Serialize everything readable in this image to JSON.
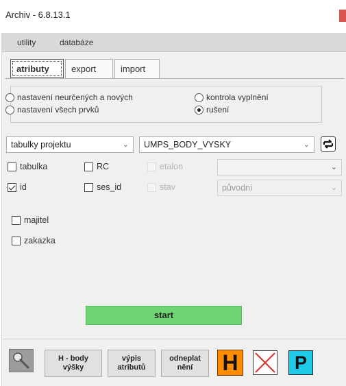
{
  "window": {
    "title": "Archiv - 6.8.13.1"
  },
  "menu": {
    "utility": "utility",
    "databaze": "databáze"
  },
  "tabs": {
    "atributy": "atributy",
    "export": "export",
    "import": "import"
  },
  "radios": {
    "neurcene": "nastavení neurčených a nových",
    "vsechny": "nastavení všech prvků",
    "kontrola": "kontrola vyplnění",
    "ruseni": "rušení",
    "selected": "rušení"
  },
  "selects": {
    "source": "tabulky projektu",
    "table": "UMPS_BODY_VYSKY",
    "etalon_value": "",
    "stav_value": "původní"
  },
  "checks": {
    "tabulka": "tabulka",
    "rc": "RC",
    "etalon": "etalon",
    "id": "id",
    "ses_id": "ses_id",
    "stav": "stav",
    "majitel": "majitel",
    "zakazka": "zakazka"
  },
  "buttons": {
    "start": "start",
    "h_body_line1": "H - body",
    "h_body_line2": "výšky",
    "vypis_line1": "výpis",
    "vypis_line2": "atributů",
    "odneplat_line1": "odneplat",
    "odneplat_line2": "nění",
    "h_label": "H",
    "p_label": "P"
  },
  "colors": {
    "start": "#6fd473",
    "h_button": "#ff8c00",
    "p_button": "#1fc9e8",
    "x_cross": "#d9372f"
  }
}
